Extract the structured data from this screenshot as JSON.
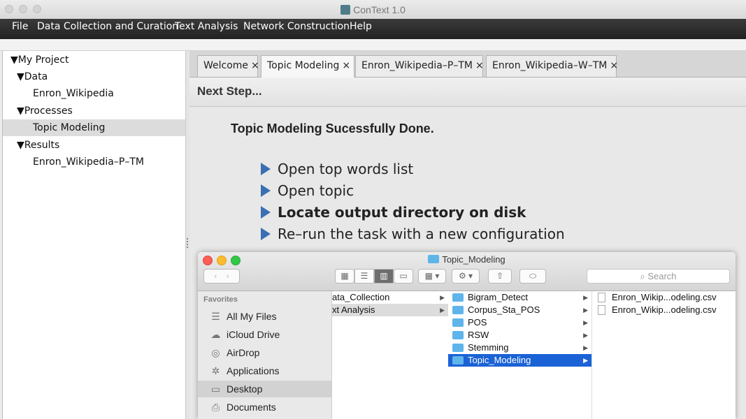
{
  "window": {
    "title": "ConText 1.0"
  },
  "menu": [
    "File",
    "Data Collection and Curation",
    "Text Analysis",
    "Network Construction",
    "Help"
  ],
  "tree": [
    {
      "label": "▼My Project"
    },
    {
      "label": "▼Data"
    },
    {
      "label": "Enron_Wikipedia"
    },
    {
      "label": "▼Processes"
    },
    {
      "label": "Topic Modeling",
      "selected": true
    },
    {
      "label": "▼Results"
    },
    {
      "label": "Enron_Wikipedia–P–TM"
    }
  ],
  "tabs": [
    {
      "label": "Welcome",
      "close": "×"
    },
    {
      "label": "Topic Modeling",
      "close": "×",
      "active": true
    },
    {
      "label": "Enron_Wikipedia–P–TM",
      "close": "×"
    },
    {
      "label": "Enron_Wikipedia–W–TM",
      "close": "×"
    }
  ],
  "next_step": "Next Step...",
  "done_message": "Topic Modeling Sucessfully Done.",
  "actions": [
    "Open top words list",
    "Open topic",
    "Locate output directory on disk",
    "Re–run the task with a new configuration"
  ],
  "finder": {
    "title": "Topic_Modeling",
    "search_placeholder": "Search",
    "favorites_header": "Favorites",
    "favorites": [
      {
        "label": "All My Files",
        "icon": "all-files-icon",
        "glyph": "☰"
      },
      {
        "label": "iCloud Drive",
        "icon": "cloud-icon",
        "glyph": "☁"
      },
      {
        "label": "AirDrop",
        "icon": "airdrop-icon",
        "glyph": "◎"
      },
      {
        "label": "Applications",
        "icon": "applications-icon",
        "glyph": "✲"
      },
      {
        "label": "Desktop",
        "icon": "desktop-icon",
        "glyph": "▭",
        "selected": true
      },
      {
        "label": "Documents",
        "icon": "documents-icon",
        "glyph": "⎙"
      }
    ],
    "column1": [
      {
        "label": "ata_Collection"
      },
      {
        "label": "xt Analysis",
        "selected": true
      }
    ],
    "column2": [
      {
        "label": "Bigram_Detect"
      },
      {
        "label": "Corpus_Sta_POS"
      },
      {
        "label": "POS"
      },
      {
        "label": "RSW"
      },
      {
        "label": "Stemming"
      },
      {
        "label": "Topic_Modeling",
        "selected": true
      }
    ],
    "column3": [
      {
        "label": "Enron_Wikip...odeling.csv"
      },
      {
        "label": "Enron_Wikip...odeling.csv"
      }
    ]
  },
  "colors": {
    "accent": "#1a62d6",
    "action_triangle": "#3b6fb3",
    "menubar": "#2c2c2c"
  }
}
